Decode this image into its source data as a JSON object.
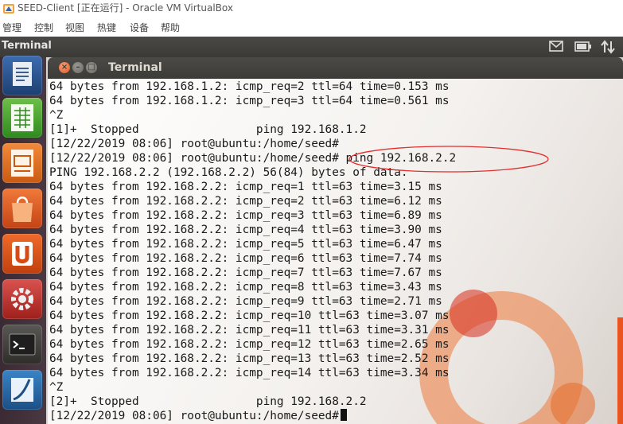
{
  "window": {
    "title": "SEED-Client [正在运行] - Oracle VM VirtualBox"
  },
  "menubar": {
    "items": [
      "管理",
      "控制",
      "视图",
      "热键",
      "设备",
      "帮助"
    ]
  },
  "top_panel": {
    "title": "Terminal",
    "indicators": [
      "mail-icon",
      "battery-icon",
      "network-icon"
    ]
  },
  "launcher": {
    "items": [
      "dash-icon",
      "libreoffice-calc-icon",
      "libreoffice-impress-icon",
      "software-center-icon",
      "ubuntu-one-icon",
      "system-settings-icon",
      "terminal-icon",
      "wireshark-icon"
    ]
  },
  "terminal": {
    "title": "Terminal",
    "lines": [
      "64 bytes from 192.168.1.2: icmp_req=2 ttl=64 time=0.153 ms",
      "64 bytes from 192.168.1.2: icmp_req=3 ttl=64 time=0.561 ms",
      "^Z",
      "[1]+  Stopped                 ping 192.168.1.2",
      "[12/22/2019 08:06] root@ubuntu:/home/seed#",
      "[12/22/2019 08:06] root@ubuntu:/home/seed# ping 192.168.2.2",
      "PING 192.168.2.2 (192.168.2.2) 56(84) bytes of data.",
      "64 bytes from 192.168.2.2: icmp_req=1 ttl=63 time=3.15 ms",
      "64 bytes from 192.168.2.2: icmp_req=2 ttl=63 time=6.12 ms",
      "64 bytes from 192.168.2.2: icmp_req=3 ttl=63 time=6.89 ms",
      "64 bytes from 192.168.2.2: icmp_req=4 ttl=63 time=3.90 ms",
      "64 bytes from 192.168.2.2: icmp_req=5 ttl=63 time=6.47 ms",
      "64 bytes from 192.168.2.2: icmp_req=6 ttl=63 time=7.74 ms",
      "64 bytes from 192.168.2.2: icmp_req=7 ttl=63 time=7.67 ms",
      "64 bytes from 192.168.2.2: icmp_req=8 ttl=63 time=3.43 ms",
      "64 bytes from 192.168.2.2: icmp_req=9 ttl=63 time=2.71 ms",
      "64 bytes from 192.168.2.2: icmp_req=10 ttl=63 time=3.07 ms",
      "64 bytes from 192.168.2.2: icmp_req=11 ttl=63 time=3.31 ms",
      "64 bytes from 192.168.2.2: icmp_req=12 ttl=63 time=2.65 ms",
      "64 bytes from 192.168.2.2: icmp_req=13 ttl=63 time=2.52 ms",
      "64 bytes from 192.168.2.2: icmp_req=14 ttl=63 time=3.34 ms",
      "^Z",
      "[2]+  Stopped                 ping 192.168.2.2",
      "[12/22/2019 08:06] root@ubuntu:/home/seed#"
    ]
  },
  "colors": {
    "annotation": "#e03030",
    "ubuntu_orange": "#e95420"
  }
}
